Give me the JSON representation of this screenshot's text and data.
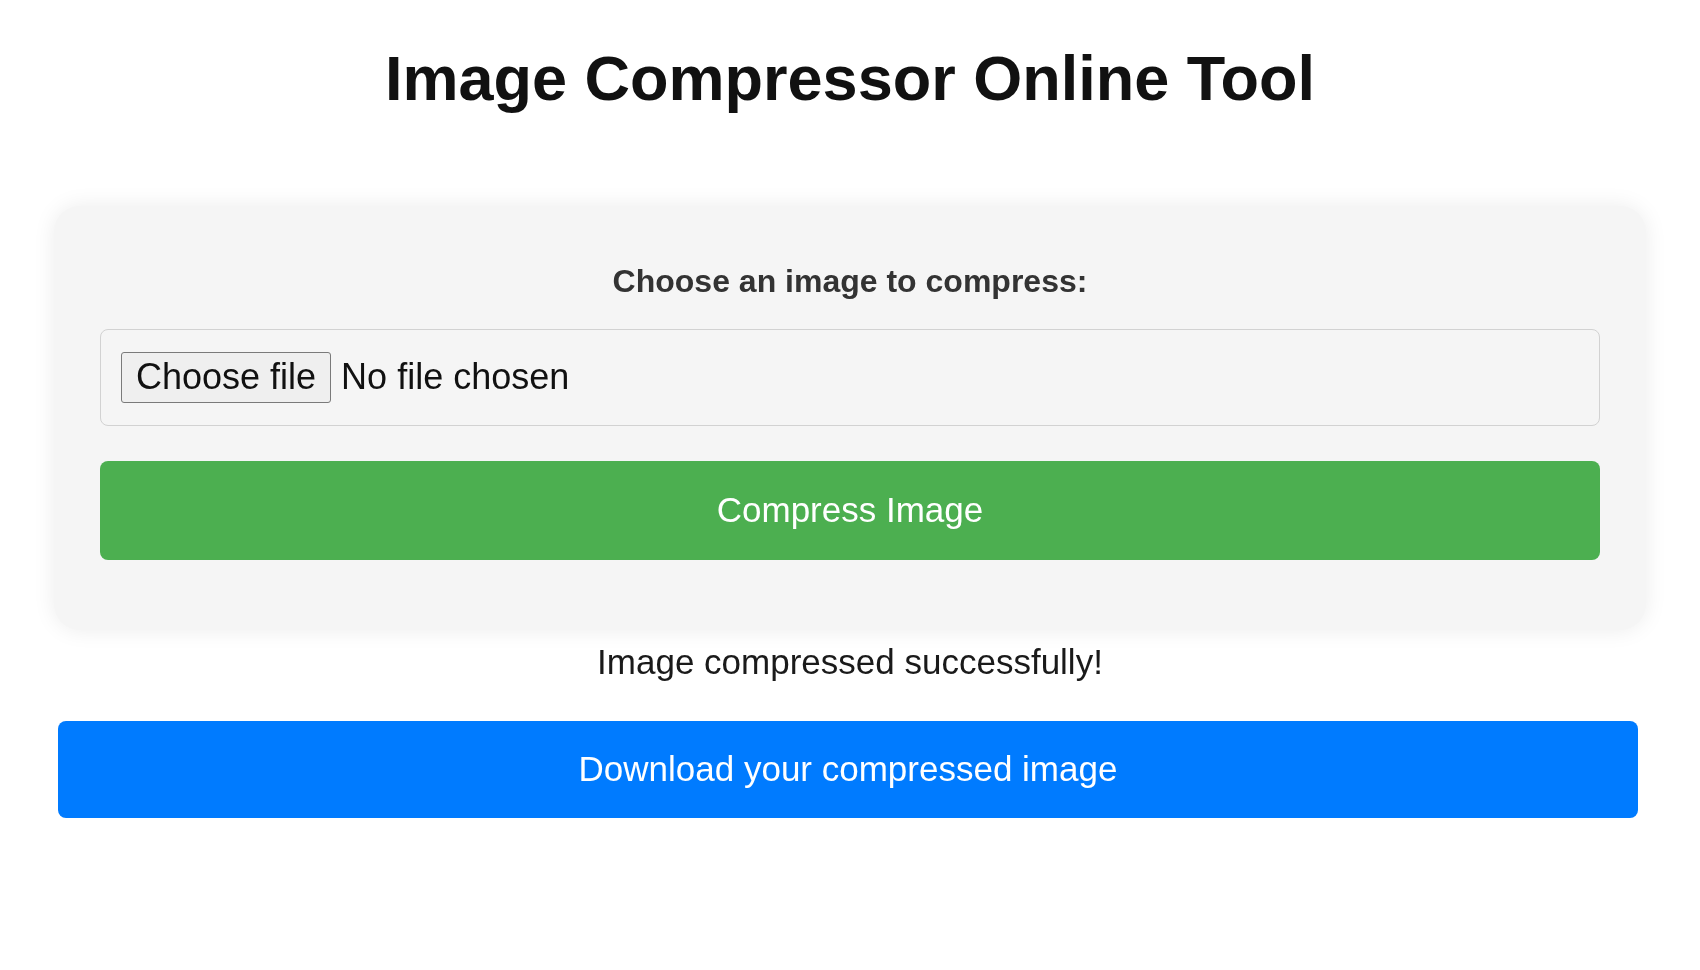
{
  "page": {
    "title": "Image Compressor Online Tool"
  },
  "upload_card": {
    "label": "Choose an image to compress:",
    "file_input": {
      "button": "Choose file",
      "status": "No file chosen"
    },
    "compress_button": "Compress Image"
  },
  "result": {
    "message": "Image compressed successfully!",
    "download_button": "Download your compressed image"
  }
}
